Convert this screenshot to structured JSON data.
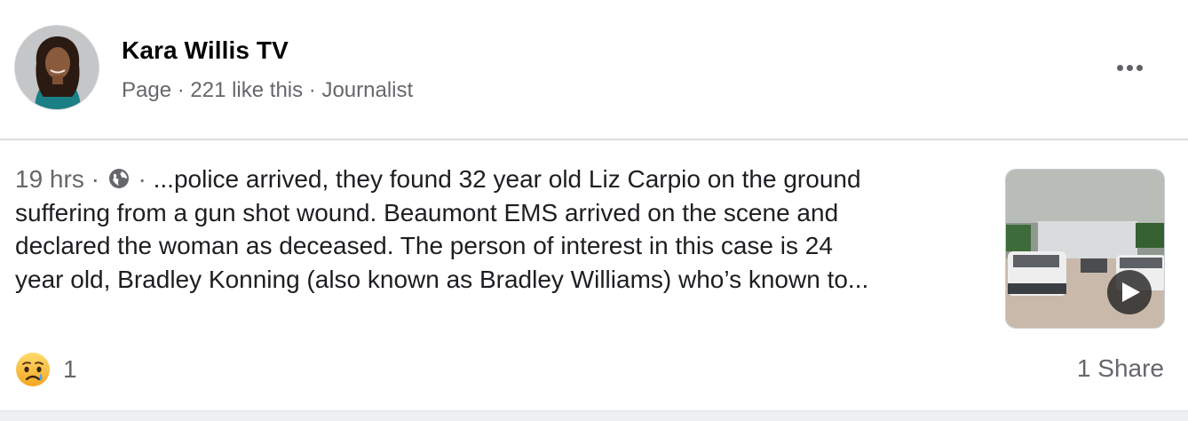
{
  "page": {
    "name": "Kara Willis TV",
    "meta": "Page · 221 like this · Journalist"
  },
  "post": {
    "time": "19 hrs",
    "sep1": " · ",
    "sep2": " · ",
    "privacy_icon": "globe-icon",
    "text_first": "...police arrived, they found 32 year old Liz Carpio on the ground",
    "text_line2": "suffering from a gun shot wound. Beaumont EMS arrived on the scene and",
    "text_line3": "declared the woman as deceased. The person of interest in this case is 24",
    "text_line4": "year old, Bradley Konning (also known as Bradley Williams) who’s known to...",
    "media_type": "video",
    "media_icon": "play-icon"
  },
  "footer": {
    "reaction_icon": "sad-face-icon",
    "reaction_count": "1",
    "shares": "1 Share"
  },
  "colors": {
    "primary_text": "#050505",
    "secondary_text": "#65676b",
    "divider": "#dadde1"
  }
}
